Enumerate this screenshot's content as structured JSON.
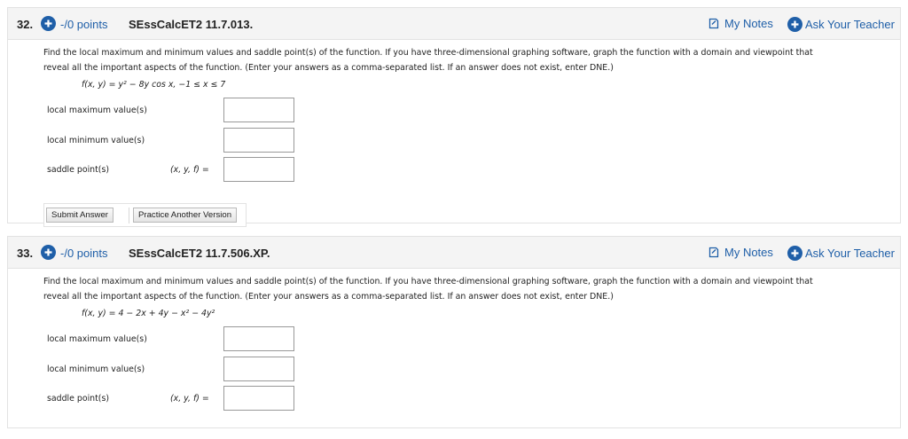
{
  "problems": [
    {
      "number": "32.",
      "points": "-/0 points",
      "code": "SEssCalcET2 11.7.013.",
      "my_notes": "My Notes",
      "ask_teacher": "Ask Your Teacher",
      "instructions_line1": "Find the local maximum and minimum values and saddle point(s) of the function. If you have three-dimensional graphing software, graph the function with a domain and viewpoint that",
      "instructions_line2": "reveal all the important aspects of the function. (Enter your answers as a comma-separated list. If an answer does not exist, enter DNE.)",
      "function_text": "f(x, y) = y² − 8y cos x,    −1 ≤ x ≤ 7",
      "fields": [
        {
          "label": "local maximum value(s)",
          "value": "",
          "prefix": ""
        },
        {
          "label": "local minimum value(s)",
          "value": "",
          "prefix": ""
        },
        {
          "label": "saddle point(s)",
          "value": "",
          "prefix": "(x, y, f)  ="
        }
      ],
      "submit_label": "Submit Answer",
      "practice_label": "Practice Another Version"
    },
    {
      "number": "33.",
      "points": "-/0 points",
      "code": "SEssCalcET2 11.7.506.XP.",
      "my_notes": "My Notes",
      "ask_teacher": "Ask Your Teacher",
      "instructions_line1": "Find the local maximum and minimum values and saddle point(s) of the function. If you have three-dimensional graphing software, graph the function with a domain and viewpoint that",
      "instructions_line2": "reveal all the important aspects of the function. (Enter your answers as a comma-separated list. If an answer does not exist, enter DNE.)",
      "function_text": "f(x, y) = 4 − 2x + 4y − x² − 4y²",
      "fields": [
        {
          "label": "local maximum value(s)",
          "value": "",
          "prefix": ""
        },
        {
          "label": "local minimum value(s)",
          "value": "",
          "prefix": ""
        },
        {
          "label": "saddle point(s)",
          "value": "",
          "prefix": "(x, y, f)  ="
        }
      ]
    }
  ],
  "colors": {
    "accent": "#1f5fa8",
    "header_bg": "#f4f4f4",
    "border": "#e2e2e2"
  },
  "icons": {
    "points": "plus-circle-icon",
    "notes": "notes-icon",
    "ask": "plus-circle-icon"
  }
}
